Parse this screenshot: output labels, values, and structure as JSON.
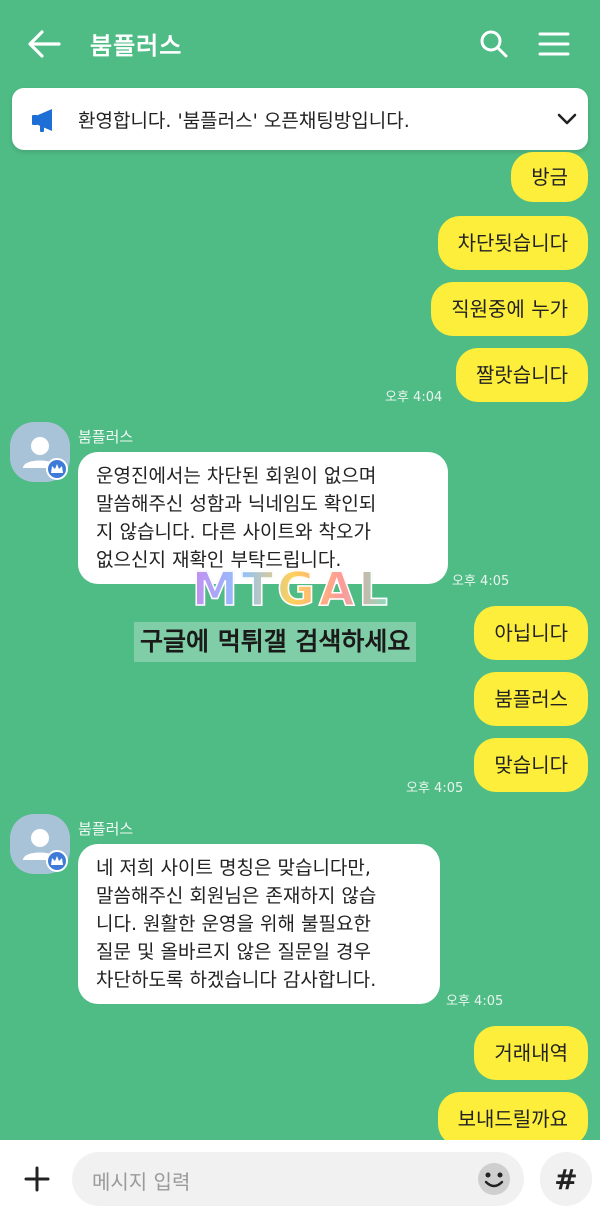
{
  "header": {
    "title": "붐플러스"
  },
  "notice": {
    "text": "환영합니다. '붐플러스' 오픈채팅방입니다."
  },
  "messages_me_1": [
    "방금",
    "차단됫습니다",
    "직원중에 누가",
    "짤랏습니다"
  ],
  "time_1": "오후 4:04",
  "sender_name": "붐플러스",
  "other_1": {
    "lines": [
      "운영진에서는 차단된 회원이 없으며",
      "말씀해주신 성함과 닉네임도 확인되",
      "지 않습니다. 다른 사이트와 착오가",
      "없으신지 재확인 부탁드립니다."
    ],
    "time": "오후 4:05"
  },
  "messages_me_2": [
    "아닙니다",
    "붐플러스",
    "맞습니다"
  ],
  "time_2": "오후 4:05",
  "other_2": {
    "lines": [
      "네 저희 사이트 명칭은 맞습니다만,",
      "말씀해주신 회원님은 존재하지 않습",
      "니다. 원활한 운영을 위해 불필요한",
      "질문 및 올바르지 않은 질문일 경우",
      "차단하도록 하겠습니다 감사합니다."
    ],
    "time": "오후 4:05"
  },
  "messages_me_3": [
    "거래내역",
    "보내드릴까요"
  ],
  "watermark": {
    "logo": "MTGAL",
    "caption": "구글에 먹튀갤 검색하세요"
  },
  "input": {
    "placeholder": "메시지 입력"
  },
  "buttons": {
    "hash": "#"
  },
  "colors": {
    "background": "#4fbb85",
    "my_bubble": "#fdee3b",
    "other_bubble": "#ffffff"
  }
}
